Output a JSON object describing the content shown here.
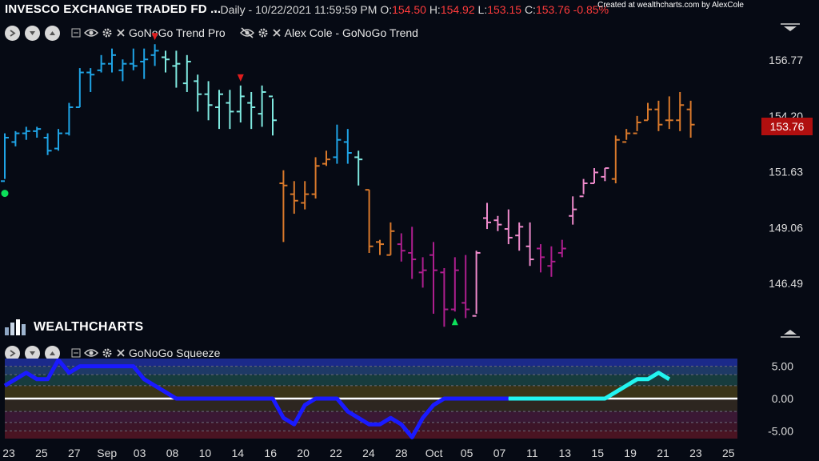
{
  "header": {
    "symbol": "INVESCO EXCHANGE TRADED FD ...",
    "interval": "- Daily - 10/22/2021 11:59:59 PM",
    "o_label": "O:",
    "o": "154.50",
    "h_label": "H:",
    "h": "154.92",
    "l_label": "L:",
    "l": "153.15",
    "c_label": "C:",
    "c": "153.76",
    "change": "-0.85%",
    "credit": "Created at wealthcharts.com by AlexCole"
  },
  "upper_indicators": {
    "first": "GoNoGo Trend Pro",
    "second": "Alex Cole - GoNoGo Trend"
  },
  "lower_indicator": {
    "label": "GoNoGo Squeeze"
  },
  "logo": {
    "text": "WEALTHCHARTS"
  },
  "last_price": "153.76",
  "chart_data": [
    {
      "type": "ohlc",
      "title": "",
      "yticks": [
        "156.77",
        "154.20",
        "151.63",
        "149.06",
        "146.49"
      ],
      "ytick_values": [
        156.77,
        154.2,
        151.63,
        149.06,
        146.49
      ],
      "y_range": [
        143.7,
        158.65
      ],
      "trend_colors": {
        "strong_go": "#1fa4e6",
        "weak_go": "#7fe9e0",
        "weak_nogo": "#ee8acb",
        "strong_nogo": "#ad1e8e",
        "amber": "#d9792b"
      },
      "bars": [
        {
          "o": 151.2,
          "h": 153.4,
          "l": 151.3,
          "c": 153.2,
          "col": "strong_go"
        },
        {
          "o": 153.0,
          "h": 153.5,
          "l": 152.8,
          "c": 153.4,
          "col": "strong_go"
        },
        {
          "o": 153.4,
          "h": 153.7,
          "l": 153.1,
          "c": 153.5,
          "col": "strong_go"
        },
        {
          "o": 153.5,
          "h": 153.7,
          "l": 153.2,
          "c": 153.6,
          "col": "strong_go"
        },
        {
          "o": 153.2,
          "h": 153.4,
          "l": 152.4,
          "c": 152.6,
          "col": "strong_go"
        },
        {
          "o": 152.7,
          "h": 153.6,
          "l": 152.6,
          "c": 153.4,
          "col": "strong_go"
        },
        {
          "o": 153.4,
          "h": 154.8,
          "l": 153.3,
          "c": 154.6,
          "col": "strong_go"
        },
        {
          "o": 154.6,
          "h": 156.4,
          "l": 154.6,
          "c": 156.2,
          "col": "strong_go"
        },
        {
          "o": 156.2,
          "h": 156.4,
          "l": 155.3,
          "c": 156.1,
          "col": "strong_go"
        },
        {
          "o": 156.3,
          "h": 157.0,
          "l": 156.2,
          "c": 156.6,
          "col": "strong_go"
        },
        {
          "o": 156.6,
          "h": 157.3,
          "l": 156.2,
          "c": 157.0,
          "col": "strong_go"
        },
        {
          "o": 156.3,
          "h": 156.8,
          "l": 155.8,
          "c": 156.6,
          "col": "strong_go"
        },
        {
          "o": 156.6,
          "h": 157.3,
          "l": 156.3,
          "c": 156.5,
          "col": "strong_go"
        },
        {
          "o": 156.7,
          "h": 157.3,
          "l": 155.9,
          "c": 156.8,
          "col": "strong_go"
        },
        {
          "o": 157.0,
          "h": 157.5,
          "l": 156.5,
          "c": 157.2,
          "col": "strong_go"
        },
        {
          "o": 156.9,
          "h": 157.2,
          "l": 156.2,
          "c": 156.8,
          "col": "weak_go"
        },
        {
          "o": 156.5,
          "h": 157.2,
          "l": 155.5,
          "c": 156.6,
          "col": "weak_go"
        },
        {
          "o": 155.7,
          "h": 157.0,
          "l": 155.3,
          "c": 156.7,
          "col": "weak_go"
        },
        {
          "o": 155.8,
          "h": 156.1,
          "l": 154.4,
          "c": 155.2,
          "col": "weak_go"
        },
        {
          "o": 155.2,
          "h": 155.8,
          "l": 154.0,
          "c": 154.7,
          "col": "weak_go"
        },
        {
          "o": 154.6,
          "h": 155.4,
          "l": 153.6,
          "c": 155.2,
          "col": "weak_go"
        },
        {
          "o": 154.8,
          "h": 155.4,
          "l": 153.6,
          "c": 154.4,
          "col": "weak_go"
        },
        {
          "o": 154.4,
          "h": 155.6,
          "l": 153.9,
          "c": 155.1,
          "col": "weak_go"
        },
        {
          "o": 154.8,
          "h": 155.3,
          "l": 153.6,
          "c": 154.6,
          "col": "weak_go"
        },
        {
          "o": 154.3,
          "h": 155.6,
          "l": 153.7,
          "c": 155.3,
          "col": "weak_go"
        },
        {
          "o": 155.1,
          "h": 155.0,
          "l": 153.3,
          "c": 154.0,
          "col": "weak_go"
        },
        {
          "o": 151.1,
          "h": 151.7,
          "l": 148.4,
          "c": 151.0,
          "col": "amber"
        },
        {
          "o": 150.6,
          "h": 151.2,
          "l": 149.7,
          "c": 150.3,
          "col": "amber"
        },
        {
          "o": 150.2,
          "h": 151.2,
          "l": 149.9,
          "c": 150.6,
          "col": "amber"
        },
        {
          "o": 150.6,
          "h": 152.3,
          "l": 150.4,
          "c": 151.9,
          "col": "amber"
        },
        {
          "o": 152.0,
          "h": 152.6,
          "l": 151.9,
          "c": 152.2,
          "col": "amber"
        },
        {
          "o": 152.3,
          "h": 153.8,
          "l": 152.0,
          "c": 153.1,
          "col": "strong_go"
        },
        {
          "o": 153.0,
          "h": 153.6,
          "l": 152.0,
          "c": 152.5,
          "col": "strong_go"
        },
        {
          "o": 152.3,
          "h": 152.6,
          "l": 151.0,
          "c": 152.2,
          "col": "weak_go"
        },
        {
          "o": 150.8,
          "h": 150.8,
          "l": 147.9,
          "c": 148.2,
          "col": "amber"
        },
        {
          "o": 148.4,
          "h": 148.5,
          "l": 147.8,
          "c": 148.3,
          "col": "amber"
        },
        {
          "o": 147.8,
          "h": 149.3,
          "l": 147.8,
          "c": 148.9,
          "col": "amber"
        },
        {
          "o": 148.3,
          "h": 148.8,
          "l": 147.5,
          "c": 148.0,
          "col": "strong_nogo"
        },
        {
          "o": 147.9,
          "h": 149.1,
          "l": 146.7,
          "c": 147.6,
          "col": "strong_nogo"
        },
        {
          "o": 147.0,
          "h": 147.7,
          "l": 146.3,
          "c": 147.1,
          "col": "strong_nogo"
        },
        {
          "o": 147.8,
          "h": 148.4,
          "l": 145.1,
          "c": 147.1,
          "col": "strong_nogo"
        },
        {
          "o": 147.0,
          "h": 147.2,
          "l": 144.5,
          "c": 145.3,
          "col": "strong_nogo"
        },
        {
          "o": 145.3,
          "h": 147.7,
          "l": 145.2,
          "c": 147.1,
          "col": "strong_nogo"
        },
        {
          "o": 145.6,
          "h": 147.8,
          "l": 144.9,
          "c": 145.3,
          "col": "strong_nogo"
        },
        {
          "o": 145.0,
          "h": 148.0,
          "l": 145.1,
          "c": 147.9,
          "col": "weak_nogo"
        },
        {
          "o": 149.5,
          "h": 150.2,
          "l": 149.0,
          "c": 149.3,
          "col": "weak_nogo"
        },
        {
          "o": 149.4,
          "h": 149.6,
          "l": 148.9,
          "c": 149.2,
          "col": "weak_nogo"
        },
        {
          "o": 149.0,
          "h": 149.9,
          "l": 148.3,
          "c": 148.6,
          "col": "weak_nogo"
        },
        {
          "o": 148.7,
          "h": 149.3,
          "l": 148.0,
          "c": 149.1,
          "col": "weak_nogo"
        },
        {
          "o": 148.2,
          "h": 149.3,
          "l": 147.3,
          "c": 147.6,
          "col": "weak_nogo"
        },
        {
          "o": 148.1,
          "h": 148.3,
          "l": 147.0,
          "c": 147.7,
          "col": "strong_nogo"
        },
        {
          "o": 147.3,
          "h": 148.2,
          "l": 146.8,
          "c": 147.5,
          "col": "strong_nogo"
        },
        {
          "o": 147.9,
          "h": 148.5,
          "l": 147.7,
          "c": 148.1,
          "col": "strong_nogo"
        },
        {
          "o": 149.6,
          "h": 150.5,
          "l": 149.2,
          "c": 149.9,
          "col": "weak_nogo"
        },
        {
          "o": 150.5,
          "h": 151.3,
          "l": 150.6,
          "c": 151.1,
          "col": "weak_nogo"
        },
        {
          "o": 151.1,
          "h": 151.8,
          "l": 151.1,
          "c": 151.6,
          "col": "weak_nogo"
        },
        {
          "o": 151.4,
          "h": 151.8,
          "l": 151.2,
          "c": 151.8,
          "col": "weak_nogo"
        },
        {
          "o": 151.3,
          "h": 153.3,
          "l": 151.1,
          "c": 153.1,
          "col": "amber"
        },
        {
          "o": 153.0,
          "h": 153.6,
          "l": 153.1,
          "c": 153.4,
          "col": "amber"
        },
        {
          "o": 153.4,
          "h": 154.2,
          "l": 153.5,
          "c": 153.9,
          "col": "amber"
        },
        {
          "o": 154.0,
          "h": 154.8,
          "l": 154.0,
          "c": 154.5,
          "col": "amber"
        },
        {
          "o": 154.5,
          "h": 154.9,
          "l": 153.5,
          "c": 153.8,
          "col": "amber"
        },
        {
          "o": 154.0,
          "h": 155.1,
          "l": 153.6,
          "c": 154.0,
          "col": "amber"
        },
        {
          "o": 154.0,
          "h": 155.3,
          "l": 153.5,
          "c": 154.7,
          "col": "amber"
        },
        {
          "o": 154.5,
          "h": 154.9,
          "l": 153.2,
          "c": 153.8,
          "col": "amber"
        }
      ],
      "markers": [
        {
          "type": "sell",
          "bar": 14,
          "color": "#e11d1d"
        },
        {
          "type": "sell",
          "bar": 22,
          "color": "#e11d1d"
        },
        {
          "type": "buy",
          "bar": 42,
          "color": "#0ce05a"
        },
        {
          "type": "dot",
          "bar": 0,
          "color": "#0ce05a"
        }
      ]
    },
    {
      "type": "line",
      "title": "GoNoGo Squeeze",
      "yticks": [
        "5.00",
        "0.00",
        "-5.00"
      ],
      "ytick_values": [
        5.0,
        0.0,
        -5.0
      ],
      "y_range": [
        -6.2,
        6.2
      ],
      "x_labels": [
        "23",
        "25",
        "27",
        "Sep",
        "03",
        "08",
        "10",
        "14",
        "16",
        "20",
        "22",
        "24",
        "28",
        "Oct",
        "05",
        "07",
        "11",
        "13",
        "15",
        "19",
        "21",
        "23",
        "25"
      ],
      "values": [
        2,
        3,
        4,
        3,
        3,
        6,
        4,
        5,
        5,
        5,
        5,
        5,
        5,
        3,
        2,
        1,
        0,
        0,
        0,
        0,
        0,
        0,
        0,
        0,
        0,
        0,
        -3,
        -4,
        -1,
        0,
        0,
        0,
        -2,
        -3,
        -4,
        -4,
        -3,
        -4,
        -6,
        -3,
        -1,
        0,
        0,
        0,
        0,
        0,
        0,
        0,
        0,
        0,
        0,
        0,
        0,
        0,
        0,
        0,
        0,
        1,
        2,
        3,
        3,
        4,
        3
      ],
      "bright_from_index": 47,
      "line_color_dark": "#1a1aff",
      "line_color_bright": "#22f4f0",
      "zero_line_color": "#ffffff"
    }
  ]
}
